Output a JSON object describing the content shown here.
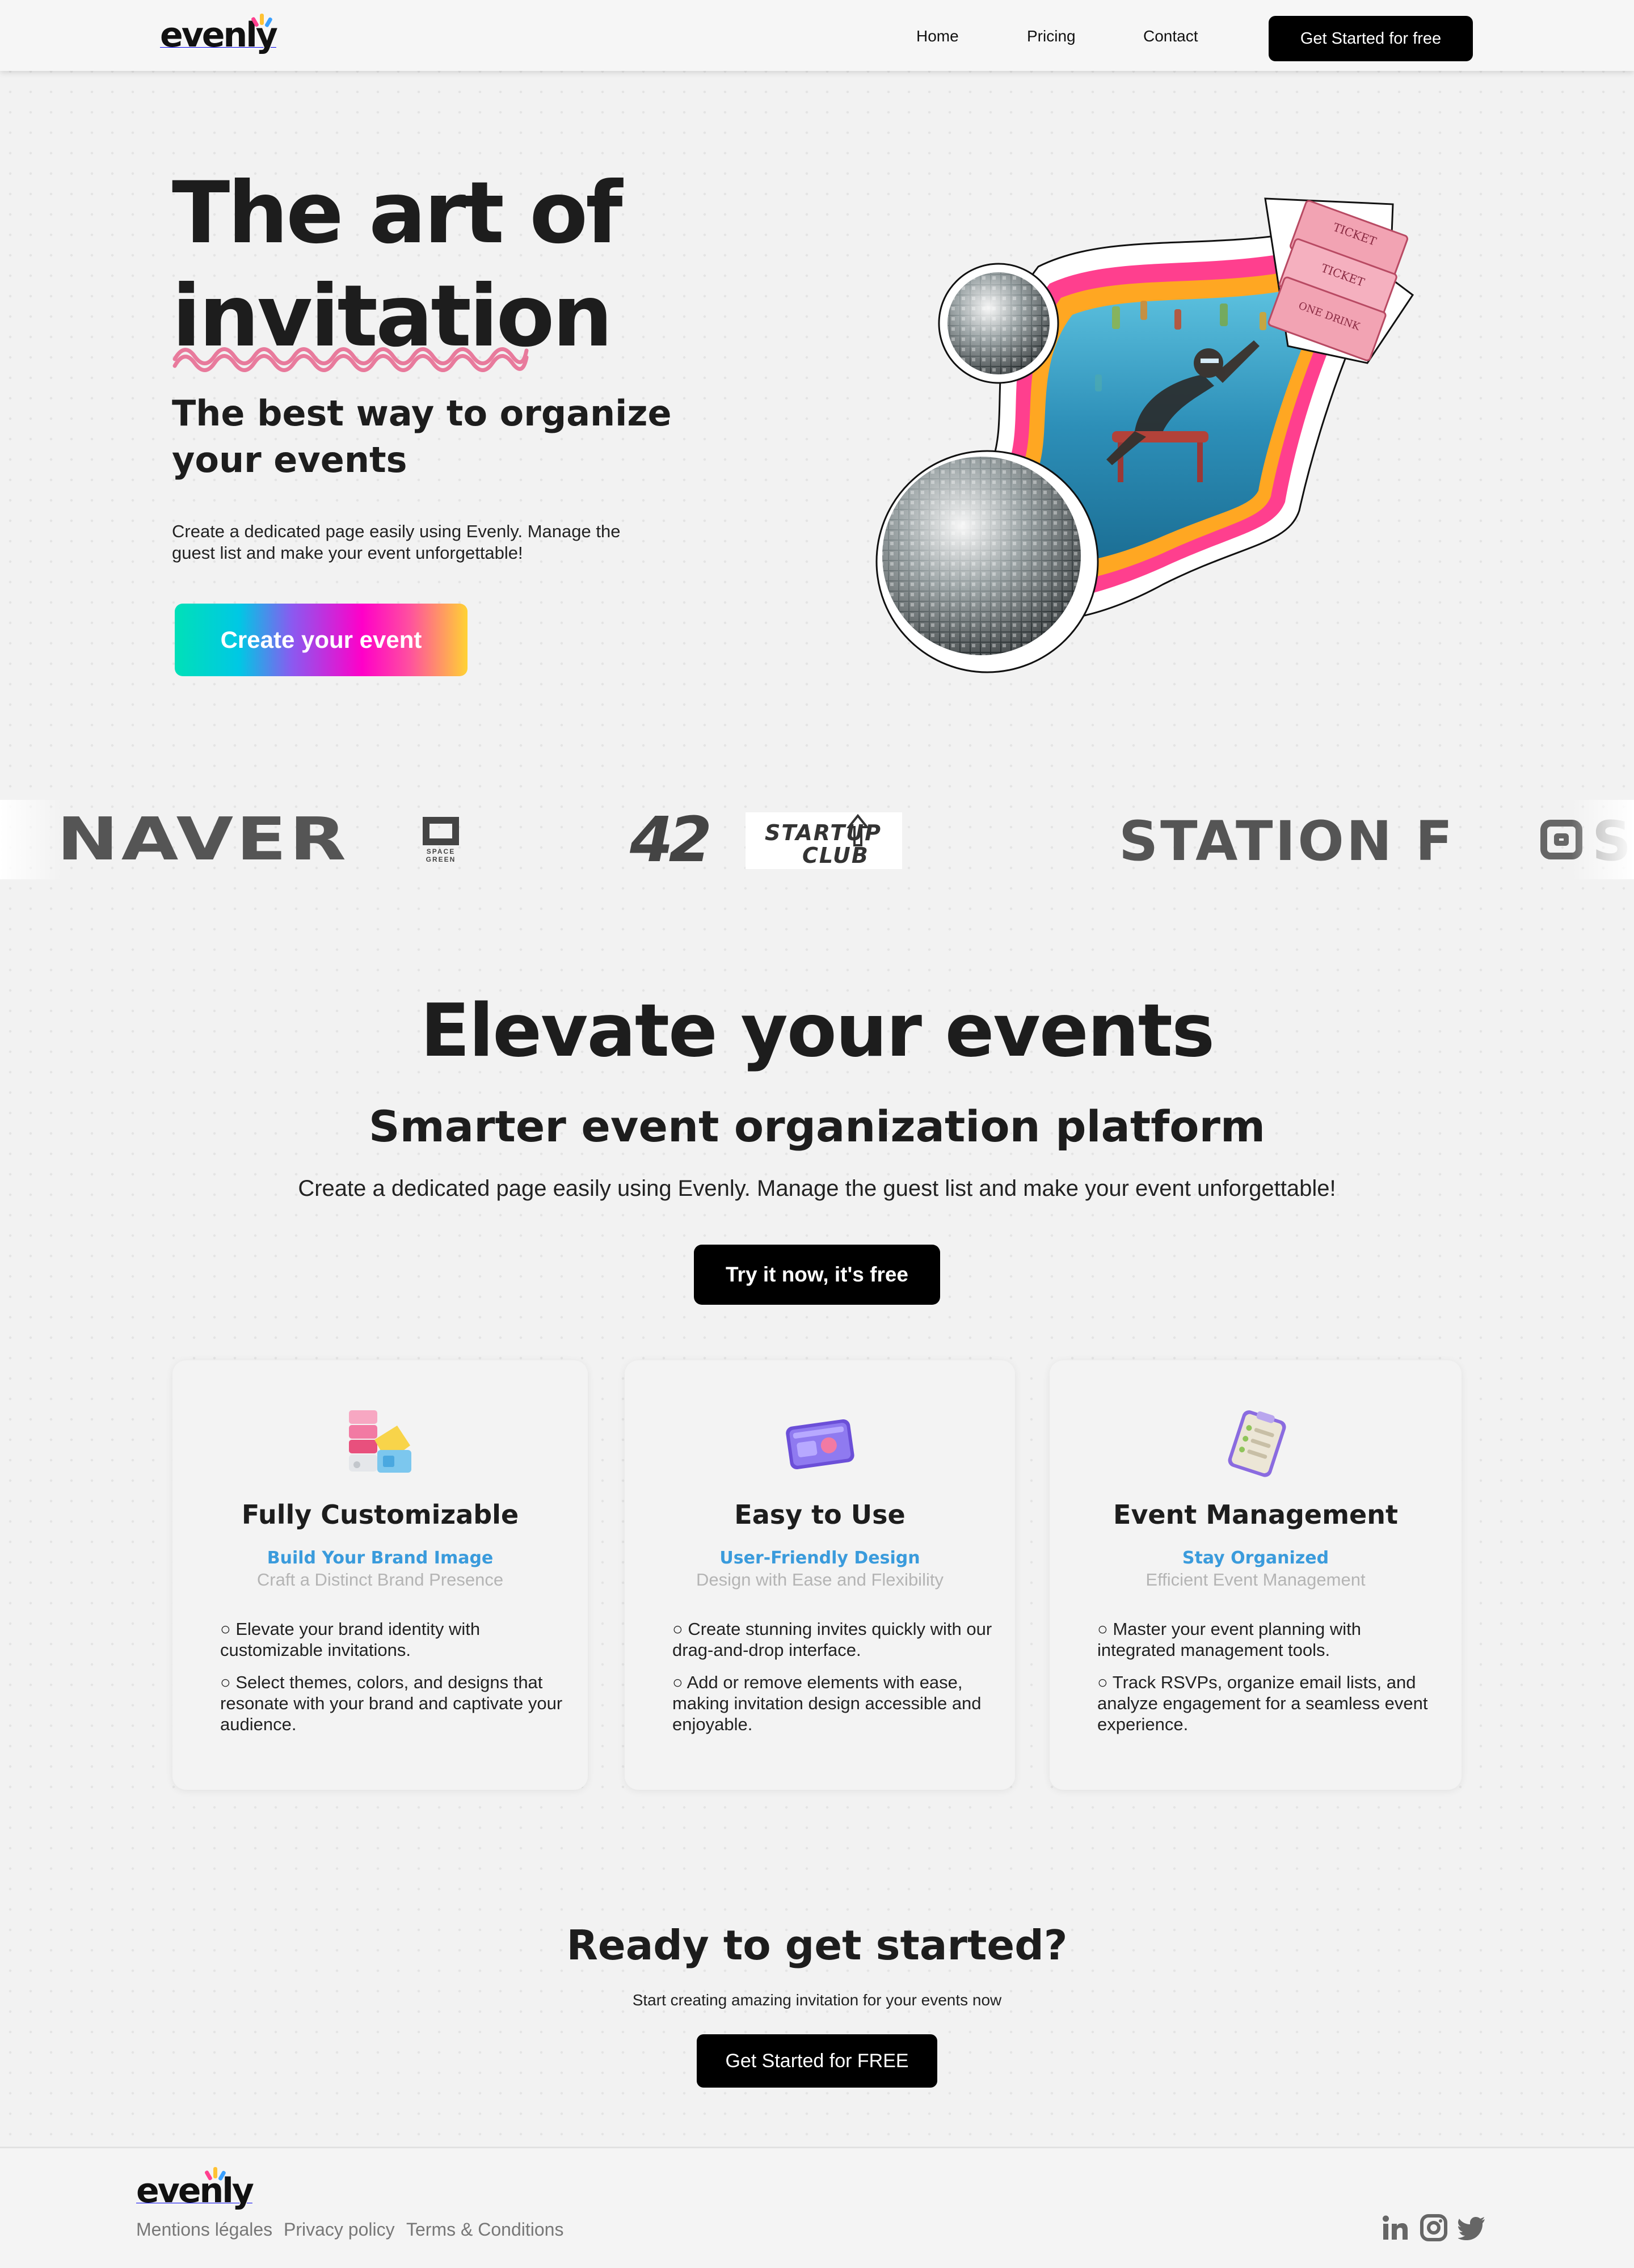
{
  "brand": {
    "name": "evenly"
  },
  "nav": {
    "items": [
      {
        "label": "Home"
      },
      {
        "label": "Pricing"
      },
      {
        "label": "Contact"
      }
    ],
    "cta": "Get Started for free"
  },
  "hero": {
    "title_line1": "The art of",
    "title_line2": "invitation",
    "subtitle": "The best way to organize your events",
    "description": "Create a dedicated page easily using Evenly. Manage the guest list and make your event unforgettable!",
    "cta": "Create your event",
    "ticket_text": [
      "TICKET",
      "TICKET",
      "ONE DRINK"
    ]
  },
  "logo_strip": {
    "logos": [
      {
        "name": "NAVER"
      },
      {
        "name": "SPACE GREEN",
        "line1": "SPACE",
        "line2": "GREEN"
      },
      {
        "name": "42"
      },
      {
        "name": "STARTUP CLUB",
        "line1": "START",
        "line2": "UP",
        "line3": "CLUB"
      },
      {
        "name": "STATION F"
      },
      {
        "name": "S"
      }
    ]
  },
  "features": {
    "title": "Elevate your events",
    "subtitle": "Smarter event organization platform",
    "description": "Create a dedicated page easily using Evenly. Manage the guest list and make your event unforgettable!",
    "cta": "Try it now, it's free",
    "cards": [
      {
        "icon": "palette-icon",
        "title": "Fully Customizable",
        "kicker": "Build Your Brand Image",
        "kicker2": "Craft a Distinct Brand Presence",
        "bullets": [
          "○ Elevate your brand identity with customizable invitations.",
          "○ Select themes, colors, and designs that resonate with your brand and captivate your audience."
        ]
      },
      {
        "icon": "browser-window-icon",
        "title": "Easy to Use",
        "kicker": "User-Friendly Design",
        "kicker2": "Design with Ease and Flexibility",
        "bullets": [
          "○ Create stunning invites quickly with our drag-and-drop interface.",
          "○ Add or remove elements with ease, making invitation design accessible and enjoyable."
        ]
      },
      {
        "icon": "checklist-icon",
        "title": "Event Management",
        "kicker": "Stay Organized",
        "kicker2": "Efficient Event Management",
        "bullets": [
          "○ Master your event planning with integrated management tools.",
          "○ Track RSVPs, organize email lists, and analyze engagement for a seamless event experience."
        ]
      }
    ]
  },
  "cta_section": {
    "title": "Ready to get started?",
    "subtitle": "Start creating amazing invitation for your events now",
    "button": "Get Started for FREE"
  },
  "footer": {
    "links": [
      {
        "label": "Mentions légales"
      },
      {
        "label": "Privacy policy"
      },
      {
        "label": "Terms & Conditions"
      }
    ],
    "social": [
      {
        "icon": "linkedin-icon"
      },
      {
        "icon": "instagram-icon"
      },
      {
        "icon": "twitter-icon"
      }
    ]
  },
  "colors": {
    "accent_blue": "#3a9bdc",
    "squiggle_pink": "#e87a9c",
    "frame_pink": "#ff3f8e",
    "frame_orange": "#ffa722"
  }
}
